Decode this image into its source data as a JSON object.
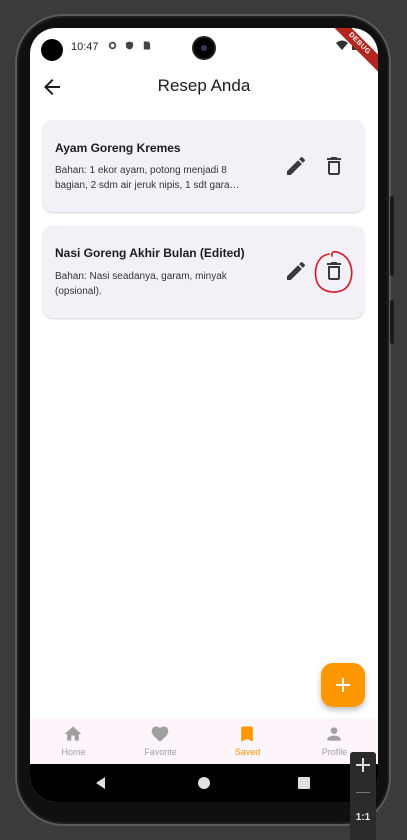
{
  "status_bar": {
    "time": "10:47",
    "debug_banner": "DEBUG"
  },
  "app_bar": {
    "title": "Resep Anda"
  },
  "recipes": [
    {
      "title": "Ayam Goreng Kremes",
      "description": "Bahan: 1 ekor ayam, potong menjadi 8 bagian, 2 sdm air jeruk nipis, 1 sdt gara…"
    },
    {
      "title": "Nasi Goreng Akhir Bulan (Edited)",
      "description": "Bahan: Nasi seadanya, garam, minyak (opsional)."
    }
  ],
  "annotation": {
    "color": "#e0141e",
    "target": "delete-icon"
  },
  "bottom_nav": {
    "items": [
      {
        "label": "Home",
        "icon": "home-icon",
        "active": false
      },
      {
        "label": "Favorite",
        "icon": "heart-icon",
        "active": false
      },
      {
        "label": "Saved",
        "icon": "bookmark-icon",
        "active": true
      },
      {
        "label": "Profile",
        "icon": "person-icon",
        "active": false
      }
    ]
  },
  "zoom": {
    "label": "1:1"
  },
  "colors": {
    "accent": "#ff9800",
    "card_bg": "#f4f0f7",
    "nav_bg": "#fdf5fb",
    "inactive": "#a0a0a0"
  }
}
